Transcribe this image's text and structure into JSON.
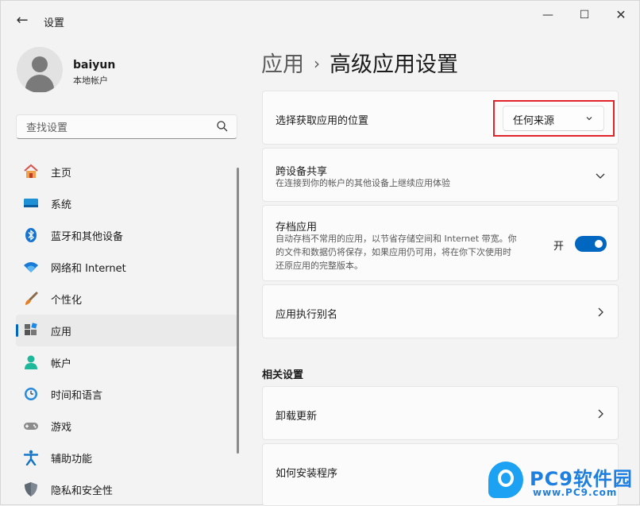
{
  "window": {
    "title": "设置",
    "minimize": "—",
    "maximize": "☐",
    "close": "✕"
  },
  "user": {
    "name": "baiyun",
    "account_type": "本地帐户"
  },
  "search": {
    "placeholder": "查找设置"
  },
  "nav": {
    "items": [
      {
        "label": "主页",
        "icon": "home-icon"
      },
      {
        "label": "系统",
        "icon": "system-icon"
      },
      {
        "label": "蓝牙和其他设备",
        "icon": "bluetooth-icon"
      },
      {
        "label": "网络和 Internet",
        "icon": "wifi-icon"
      },
      {
        "label": "个性化",
        "icon": "brush-icon"
      },
      {
        "label": "应用",
        "icon": "apps-icon",
        "active": true
      },
      {
        "label": "帐户",
        "icon": "account-icon"
      },
      {
        "label": "时间和语言",
        "icon": "clock-globe-icon"
      },
      {
        "label": "游戏",
        "icon": "gamepad-icon"
      },
      {
        "label": "辅助功能",
        "icon": "accessibility-icon"
      },
      {
        "label": "隐私和安全性",
        "icon": "shield-icon"
      }
    ]
  },
  "breadcrumb": {
    "parent": "应用",
    "separator": "›",
    "current": "高级应用设置"
  },
  "settings": {
    "app_source": {
      "title": "选择获取应用的位置",
      "value": "任何来源"
    },
    "share": {
      "title": "跨设备共享",
      "desc": "在连接到你的帐户的其他设备上继续应用体验"
    },
    "archive": {
      "title": "存档应用",
      "desc_lines": [
        "自动存档不常用的应用，以节省存储空间和 Internet 带宽。你",
        "的文件和数据仍将保存，如果应用仍可用，将在你下次使用时",
        "还原应用的完整版本。"
      ],
      "toggle_label": "开",
      "toggle_on": true
    },
    "alias": {
      "title": "应用执行别名"
    }
  },
  "related": {
    "heading": "相关设置",
    "uninstall": {
      "title": "卸载更新"
    },
    "install": {
      "title": "如何安装程序"
    }
  },
  "watermark": {
    "brand": "PC9软件园",
    "url": "www.PC9.com"
  },
  "colors": {
    "accent": "#0067c0",
    "highlight": "#e0242b",
    "brand": "#1d7fe0"
  }
}
